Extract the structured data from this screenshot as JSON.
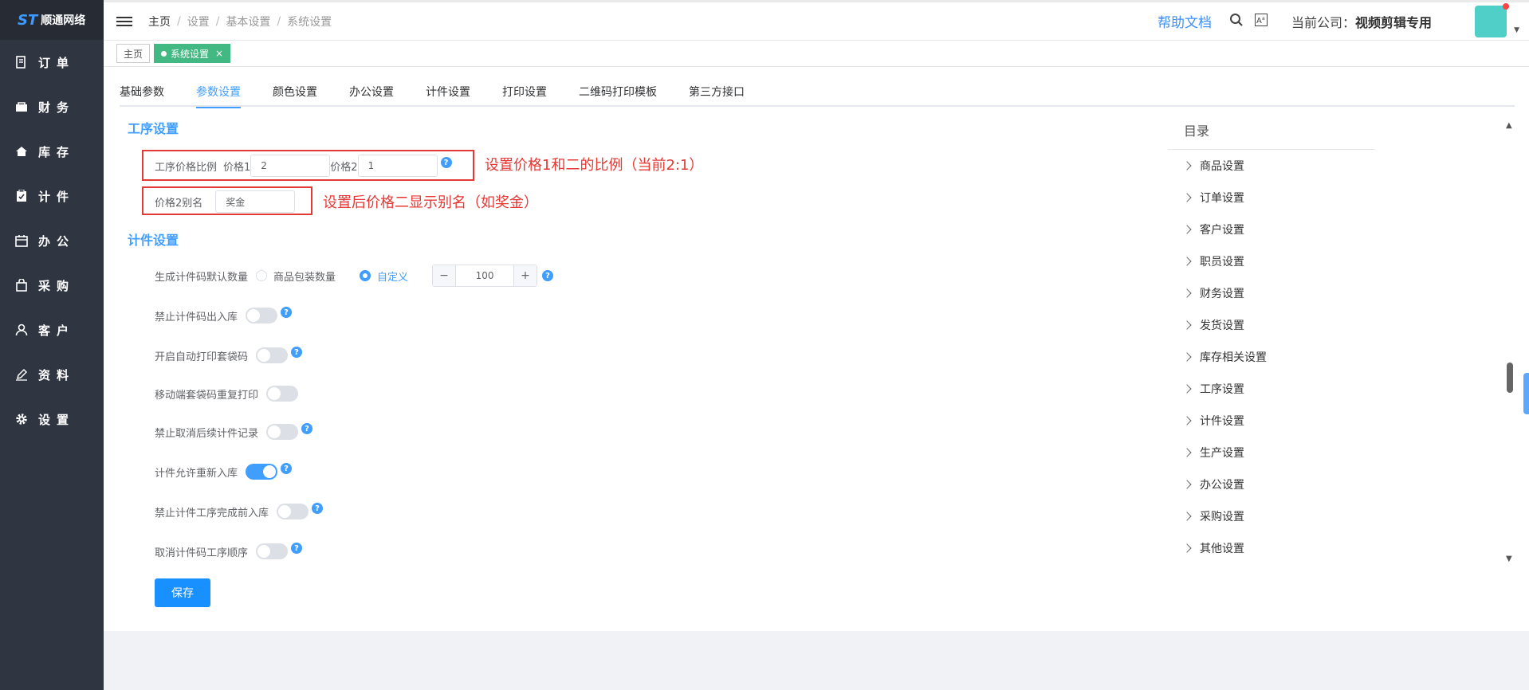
{
  "app": {
    "logo_text": "顺通网络",
    "logo_mark": "ST"
  },
  "sidebar": {
    "items": [
      {
        "label": "订单",
        "icon": "order-icon"
      },
      {
        "label": "财务",
        "icon": "finance-icon"
      },
      {
        "label": "库存",
        "icon": "home-icon"
      },
      {
        "label": "计件",
        "icon": "clipboard-icon"
      },
      {
        "label": "办公",
        "icon": "calendar-icon"
      },
      {
        "label": "采购",
        "icon": "bag-icon"
      },
      {
        "label": "客户",
        "icon": "user-icon"
      },
      {
        "label": "资料",
        "icon": "pen-icon"
      },
      {
        "label": "设置",
        "icon": "gear-icon"
      }
    ]
  },
  "header": {
    "breadcrumb": [
      "主页",
      "设置",
      "基本设置",
      "系统设置"
    ],
    "help": "帮助文档",
    "company_label": "当前公司：",
    "company_name": "视频剪辑专用"
  },
  "tagsbar": {
    "home": "主页",
    "active": "系统设置",
    "close": "×"
  },
  "tabs": [
    "基础参数",
    "参数设置",
    "颜色设置",
    "办公设置",
    "计件设置",
    "打印设置",
    "二维码打印模板",
    "第三方接口"
  ],
  "process": {
    "title": "工序设置",
    "ratio_label": "工序价格比例",
    "price1_label": "价格1",
    "price1_value": "2",
    "price2_label": "价格2",
    "price2_value": "1",
    "alias_label": "价格2别名",
    "alias_value": "奖金",
    "annotation1": "设置价格1和二的比例（当前2:1）",
    "annotation2": "设置后价格二显示别名（如奖金）"
  },
  "piece": {
    "title": "计件设置",
    "default_qty_label": "生成计件码默认数量",
    "option_pack": "商品包装数量",
    "option_custom": "自定义",
    "qty_value": "100",
    "minus": "−",
    "plus": "+",
    "switches": [
      {
        "label": "禁止计件码出入库",
        "on": false,
        "help": true
      },
      {
        "label": "开启自动打印套袋码",
        "on": false,
        "help": true
      },
      {
        "label": "移动端套袋码重复打印",
        "on": false,
        "help": false
      },
      {
        "label": "禁止取消后续计件记录",
        "on": false,
        "help": true
      },
      {
        "label": "计件允许重新入库",
        "on": true,
        "help": true
      },
      {
        "label": "禁止计件工序完成前入库",
        "on": false,
        "help": true
      },
      {
        "label": "取消计件码工序顺序",
        "on": false,
        "help": true
      }
    ],
    "help_mark": "?",
    "save": "保存"
  },
  "toc": {
    "title": "目录",
    "items": [
      "商品设置",
      "订单设置",
      "客户设置",
      "职员设置",
      "财务设置",
      "发货设置",
      "库存相关设置",
      "工序设置",
      "计件设置",
      "生产设置",
      "办公设置",
      "采购设置",
      "其他设置"
    ]
  },
  "colors": {
    "accent": "#409eff",
    "sidebar": "#2f3541",
    "annotation": "#e53935",
    "tag_active": "#42b983"
  }
}
